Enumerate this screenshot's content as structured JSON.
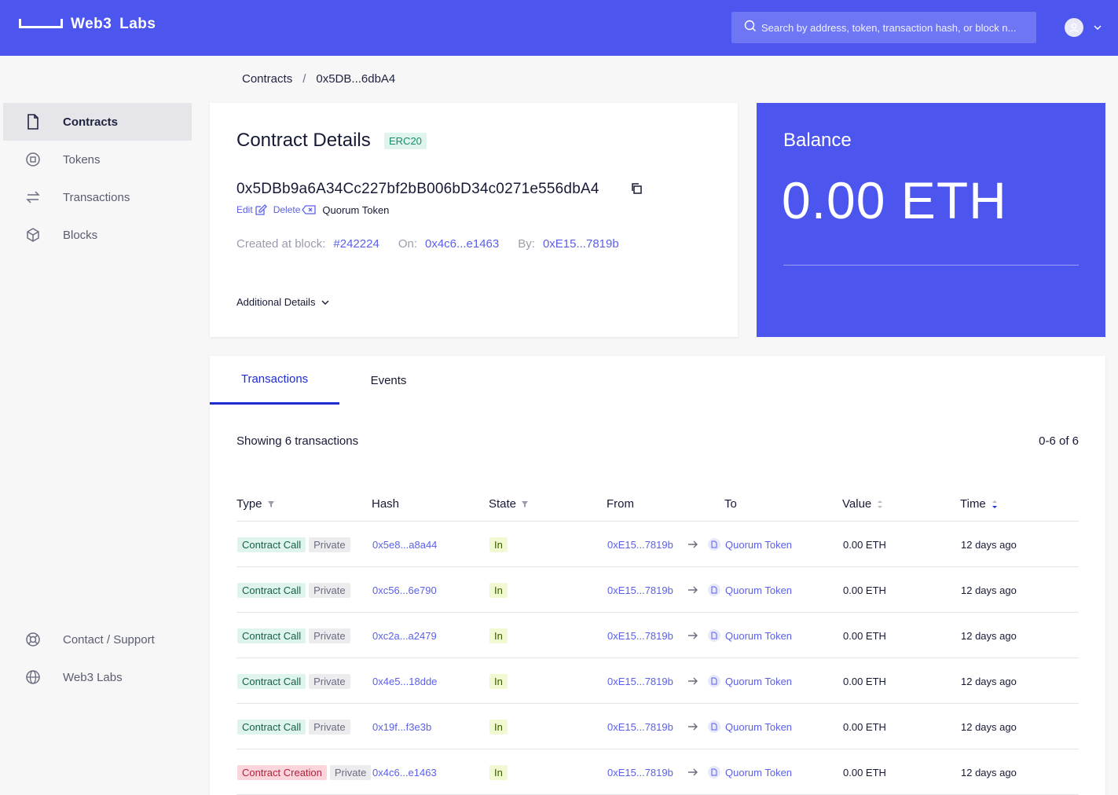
{
  "app": {
    "brand_name": "Web3  Labs",
    "brand_color": "#4d55ef"
  },
  "search": {
    "placeholder": "Search by address, token, transaction hash, or block n..."
  },
  "breadcrumb": {
    "root": "Contracts",
    "separator": "/",
    "current": "0x5DB...6dbA4"
  },
  "sidebar": {
    "items": [
      {
        "label": "Contracts",
        "icon": "document-icon",
        "active": true
      },
      {
        "label": "Tokens",
        "icon": "token-icon",
        "active": false
      },
      {
        "label": "Transactions",
        "icon": "transfer-icon",
        "active": false
      },
      {
        "label": "Blocks",
        "icon": "cube-icon",
        "active": false
      }
    ],
    "footer": [
      {
        "label": "Contact / Support",
        "icon": "lifebuoy-icon"
      },
      {
        "label": "Web3 Labs",
        "icon": "globe-icon"
      }
    ]
  },
  "contract": {
    "title": "Contract Details",
    "badge": "ERC20",
    "address": "0x5DBb9a6A34Cc227bf2bB006bD34c0271e556dbA4",
    "edit_label": "Edit",
    "delete_label": "Delete",
    "name": "Quorum Token",
    "created_label": "Created at block:",
    "created_block": "#242224",
    "on_label": "On:",
    "on_tx": "0x4c6...e1463",
    "by_label": "By:",
    "by_address": "0xE15...7819b",
    "additional_label": "Additional Details"
  },
  "balance": {
    "title": "Balance",
    "value": "0.00 ETH"
  },
  "tabs": [
    {
      "label": "Transactions",
      "active": true
    },
    {
      "label": "Events",
      "active": false
    }
  ],
  "transactions": {
    "showing": "Showing 6 transactions",
    "range": "0-6 of 6",
    "columns": {
      "type": "Type",
      "hash": "Hash",
      "state": "State",
      "from": "From",
      "to": "To",
      "value": "Value",
      "time": "Time"
    },
    "rows": [
      {
        "type": "Contract Call",
        "type_kind": "call",
        "privacy": "Private",
        "hash": "0x5e8...a8a44",
        "state": "In",
        "from": "0xE15...7819b",
        "to": "Quorum Token",
        "value": "0.00 ETH",
        "time": "12 days ago"
      },
      {
        "type": "Contract Call",
        "type_kind": "call",
        "privacy": "Private",
        "hash": "0xc56...6e790",
        "state": "In",
        "from": "0xE15...7819b",
        "to": "Quorum Token",
        "value": "0.00 ETH",
        "time": "12 days ago"
      },
      {
        "type": "Contract Call",
        "type_kind": "call",
        "privacy": "Private",
        "hash": "0xc2a...a2479",
        "state": "In",
        "from": "0xE15...7819b",
        "to": "Quorum Token",
        "value": "0.00 ETH",
        "time": "12 days ago"
      },
      {
        "type": "Contract Call",
        "type_kind": "call",
        "privacy": "Private",
        "hash": "0x4e5...18dde",
        "state": "In",
        "from": "0xE15...7819b",
        "to": "Quorum Token",
        "value": "0.00 ETH",
        "time": "12 days ago"
      },
      {
        "type": "Contract Call",
        "type_kind": "call",
        "privacy": "Private",
        "hash": "0x19f...f3e3b",
        "state": "In",
        "from": "0xE15...7819b",
        "to": "Quorum Token",
        "value": "0.00 ETH",
        "time": "12 days ago"
      },
      {
        "type": "Contract Creation",
        "type_kind": "create",
        "privacy": "Private",
        "hash": "0x4c6...e1463",
        "state": "In",
        "from": "0xE15...7819b",
        "to": "Quorum Token",
        "value": "0.00 ETH",
        "time": "12 days ago"
      }
    ]
  }
}
